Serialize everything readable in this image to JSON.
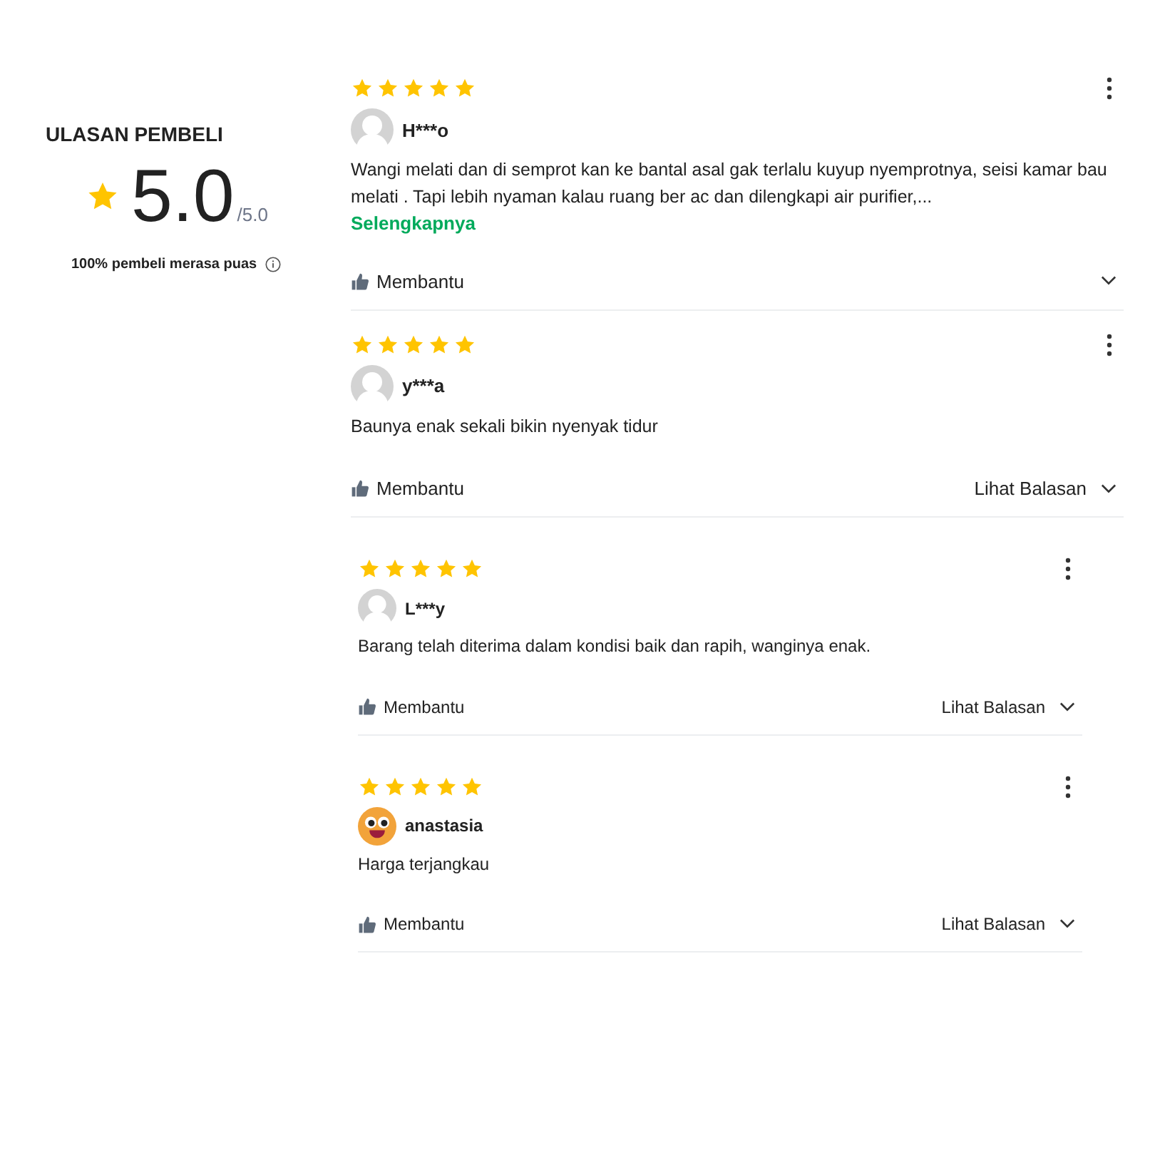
{
  "summary": {
    "title": "ULASAN PEMBELI",
    "rating": "5.0",
    "out_of": "/5.0",
    "satisfaction": "100% pembeli merasa puas"
  },
  "reviews": [
    {
      "stars": 5,
      "avatar": {
        "kind": "silhouette"
      },
      "name": "H***o",
      "text": "Wangi melati dan di semprot kan ke bantal asal gak terlalu kuyup nyemprotnya, seisi kamar bau melati . Tapi lebih nyaman kalau ruang ber ac dan dilengkapi air purifier,...",
      "more": "Selengkapnya",
      "helpful": "Membantu"
    },
    {
      "stars": 5,
      "avatar": {
        "kind": "silhouette"
      },
      "name": "y***a",
      "text": "Baunya enak sekali bikin nyenyak tidur",
      "helpful": "Membantu",
      "replies": "Lihat Balasan"
    },
    {
      "stars": 5,
      "avatar": {
        "kind": "silhouette"
      },
      "name": "L***y",
      "text": "Barang telah diterima dalam kondisi baik dan rapih, wanginya enak.",
      "helpful": "Membantu",
      "replies": "Lihat Balasan"
    },
    {
      "stars": 5,
      "avatar": {
        "kind": "emoji"
      },
      "name": "anastasia",
      "text": "Harga terjangkau",
      "helpful": "Membantu",
      "replies": "Lihat Balasan"
    }
  ]
}
